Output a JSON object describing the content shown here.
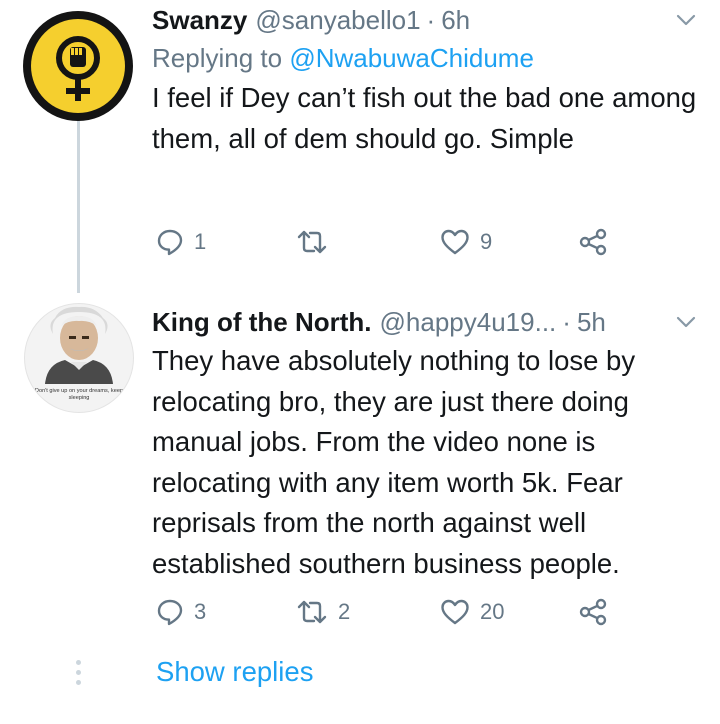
{
  "tweets": [
    {
      "display_name": "Swanzy",
      "handle": "@sanyabello1",
      "separator": "·",
      "time": "6h",
      "replying_prefix": "Replying to",
      "replying_mention": "@NwabuwaChidume",
      "text": "I feel if Dey can’t fish out the bad one among them, all of dem should go. Simple",
      "reply_count": "1",
      "retweet_count": "",
      "like_count": "9"
    },
    {
      "display_name": "King of the North.",
      "handle": "@happy4u19...",
      "separator": "·",
      "time": "5h",
      "text": "They have absolutely nothing to lose by relocating bro, they are just there doing manual jobs. From the video none is relocating with any item worth 5k. Fear reprisals from the north against well established southern business people.",
      "avatar_caption": "Don't give up on your dreams, keep sleeping",
      "reply_count": "3",
      "retweet_count": "2",
      "like_count": "20"
    }
  ],
  "show_replies_label": "Show replies",
  "icons": {
    "reply": "reply-icon",
    "retweet": "retweet-icon",
    "like": "heart-icon",
    "share": "share-icon",
    "menu": "chevron-down-icon",
    "avatar_symbol": "feminist-fist-icon"
  },
  "colors": {
    "link": "#1da1f2",
    "secondary_text": "#657786",
    "thread_line": "#ccd6dd",
    "avatar_yellow": "#f5cf2e"
  }
}
